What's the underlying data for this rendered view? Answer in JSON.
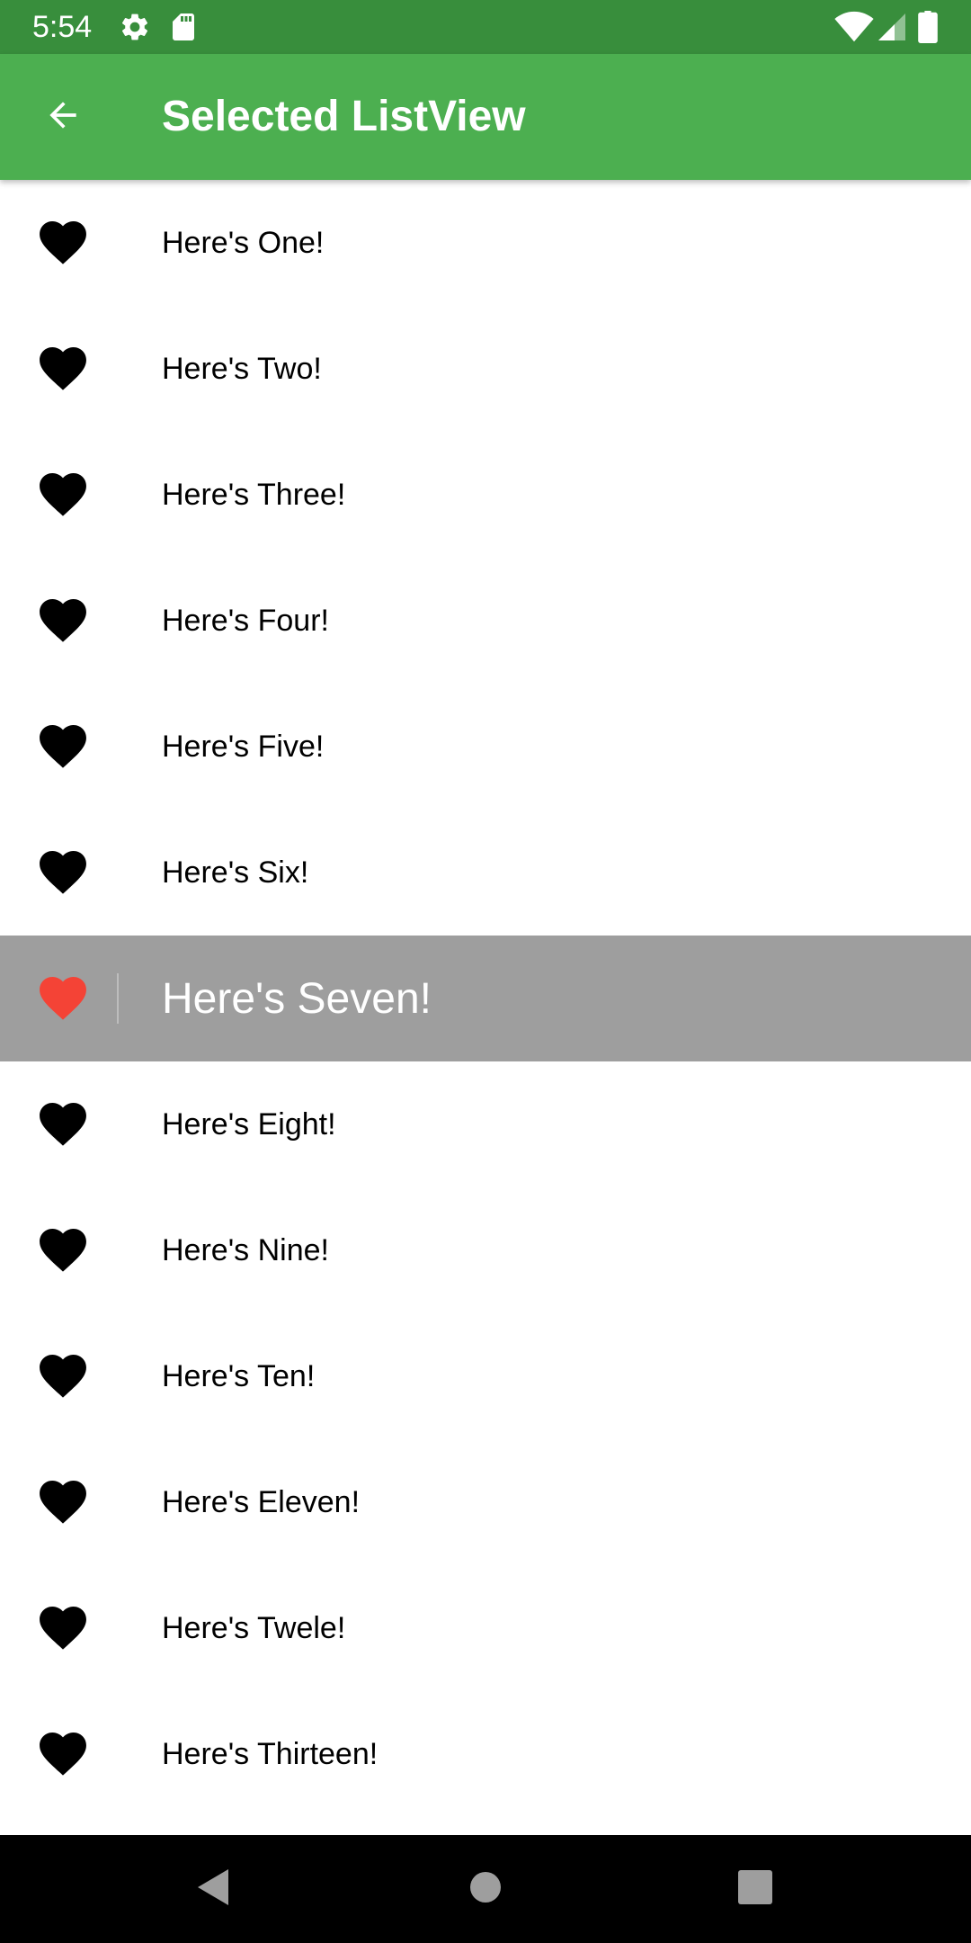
{
  "status_bar": {
    "time": "5:54",
    "icons_left": [
      "gear-icon",
      "sd-card-icon"
    ],
    "icons_right": [
      "wifi-icon",
      "cell-signal-icon",
      "battery-icon"
    ]
  },
  "app_bar": {
    "title": "Selected ListView",
    "back_icon": "arrow-back-icon"
  },
  "list": {
    "items": [
      {
        "label": "Here's One!",
        "selected": false
      },
      {
        "label": "Here's Two!",
        "selected": false
      },
      {
        "label": "Here's Three!",
        "selected": false
      },
      {
        "label": "Here's Four!",
        "selected": false
      },
      {
        "label": "Here's Five!",
        "selected": false
      },
      {
        "label": "Here's Six!",
        "selected": false
      },
      {
        "label": "Here's Seven!",
        "selected": true
      },
      {
        "label": "Here's Eight!",
        "selected": false
      },
      {
        "label": "Here's Nine!",
        "selected": false
      },
      {
        "label": "Here's Ten!",
        "selected": false
      },
      {
        "label": "Here's Eleven!",
        "selected": false
      },
      {
        "label": "Here's Twele!",
        "selected": false
      },
      {
        "label": "Here's Thirteen!",
        "selected": false
      }
    ],
    "item_icon": "heart-icon"
  },
  "nav_bar": {
    "buttons": [
      "back-triangle-icon",
      "home-circle-icon",
      "recents-square-icon"
    ]
  },
  "colors": {
    "status_bar": "#388e3c",
    "app_bar": "#4caf50",
    "selected_row": "#9e9e9e",
    "heart_default": "#000000",
    "heart_selected": "#f44336",
    "nav_bar": "#000000"
  }
}
